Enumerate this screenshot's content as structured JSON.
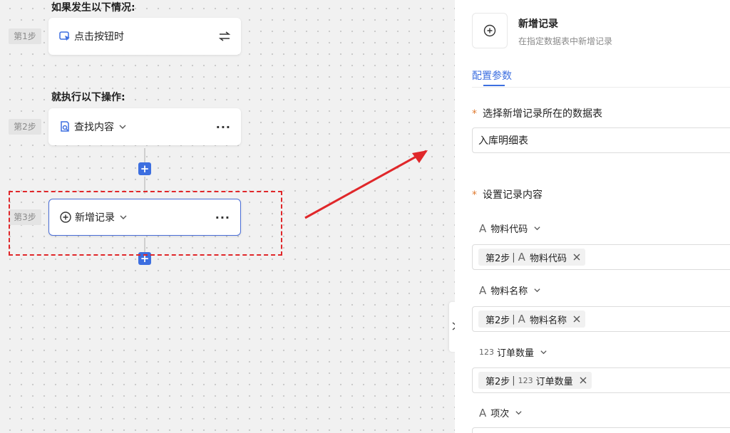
{
  "canvas": {
    "trigger_heading": "如果发生以下情况:",
    "action_heading": "就执行以下操作:",
    "steps": [
      {
        "tag": "第1步",
        "label": "点击按钮时",
        "icon": "cursor-click-icon",
        "right_icon": "swap-icon"
      },
      {
        "tag": "第2步",
        "label": "查找内容",
        "icon": "search-doc-icon",
        "more": "···"
      },
      {
        "tag": "第3步",
        "label": "新增记录",
        "icon": "plus-circle-icon",
        "more": "···"
      }
    ],
    "add_button": "+"
  },
  "panel": {
    "title": "新增记录",
    "subtitle": "在指定数据表中新增记录",
    "tab": "配置参数",
    "required_mark": "*",
    "table_label": "选择新增记录所在的数据表",
    "table_value": "入库明细表",
    "content_label": "设置记录内容",
    "fields": [
      {
        "type_glyph": "A",
        "name": "物料代码",
        "chip_step": "第2步",
        "chip_sep": "|",
        "chip_type": "A",
        "chip_field": "物料代码"
      },
      {
        "type_glyph": "A",
        "name": "物料名称",
        "chip_step": "第2步",
        "chip_sep": "|",
        "chip_type": "A",
        "chip_field": "物料名称"
      },
      {
        "type_glyph": "123",
        "name": "订单数量",
        "chip_step": "第2步",
        "chip_sep": "|",
        "chip_type": "123",
        "chip_field": "订单数量"
      },
      {
        "type_glyph": "A",
        "name": "项次"
      }
    ]
  },
  "colors": {
    "accent": "#3d6fe0",
    "highlight": "#e0272a",
    "required": "#e07a2f"
  }
}
